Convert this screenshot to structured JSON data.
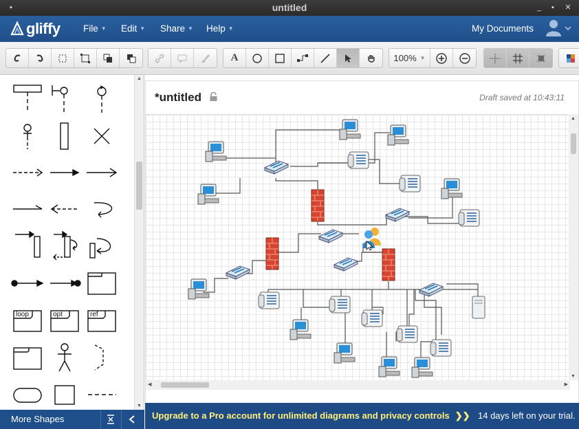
{
  "window": {
    "title": "untitled"
  },
  "app": {
    "logo_text": "gliffy"
  },
  "menu": {
    "items": [
      "File",
      "Edit",
      "Share",
      "Help"
    ],
    "my_documents": "My Documents"
  },
  "toolbar": {
    "zoom": "100%",
    "tools": [
      "undo-icon",
      "redo-icon",
      "select-frame-icon",
      "group-icon",
      "bring-front-icon",
      "send-back-icon",
      "link-icon",
      "comment-icon",
      "style-brush-icon",
      "text-tool-icon",
      "ellipse-tool-icon",
      "rectangle-tool-icon",
      "connector-tool-icon",
      "line-tool-icon",
      "pointer-tool-icon",
      "pan-hand-icon",
      "zoom-in-icon",
      "zoom-out-icon",
      "snap-guides-icon",
      "grid-toggle-icon",
      "snap-grid-icon",
      "themes-icon"
    ]
  },
  "sidebar": {
    "more_shapes": "More Shapes",
    "uml_labels": [
      "loop",
      "opt",
      "ref"
    ]
  },
  "document": {
    "title": "*untitled",
    "status": "Draft saved at 10:43:11"
  },
  "banner": {
    "cta": "Upgrade to a Pro account for unlimited diagrams and privacy controls",
    "arrows": "❯❯",
    "trial": "14 days left on your trial."
  },
  "colors": {
    "menubar": "#205493",
    "banner": "#1e4b86",
    "cta_text": "#ffef7a"
  }
}
